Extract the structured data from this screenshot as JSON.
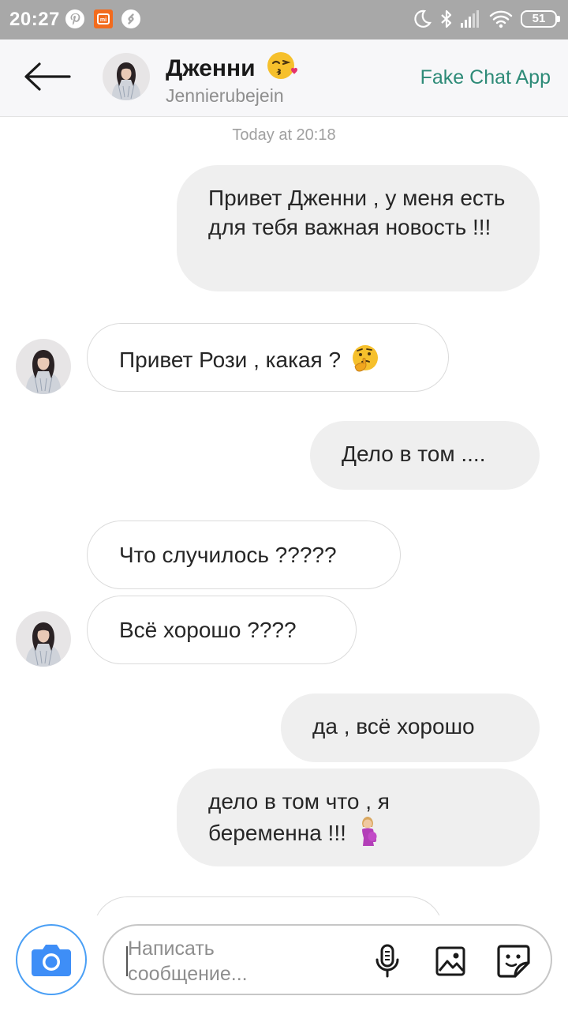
{
  "status_bar": {
    "time": "20:27",
    "battery": "51"
  },
  "header": {
    "name": "Дженни",
    "name_emoji": "face-blowing-kiss",
    "username": "Jennierubejein",
    "app_label": "Fake Chat App"
  },
  "chat": {
    "timestamp": "Today at 20:18",
    "messages": [
      {
        "side": "outgoing",
        "text": "Привет Дженни , у меня есть для тебя  важная новость !!!"
      },
      {
        "side": "incoming",
        "text": "Привет Рози , какая ?",
        "emoji": "thinking-face"
      },
      {
        "side": "outgoing",
        "text": "Дело в том ...."
      },
      {
        "side": "incoming",
        "text": "Что случилось ?????"
      },
      {
        "side": "incoming",
        "text": "Всё хорошо ????"
      },
      {
        "side": "outgoing",
        "text": "да , всё хорошо"
      },
      {
        "side": "outgoing",
        "text": "дело в том что , я беременна !!!",
        "emoji": "pregnant-woman"
      }
    ]
  },
  "composer": {
    "placeholder": "Написать сообщение...",
    "camera_color": "#3e8ef7",
    "accent_color": "#2e8b78"
  }
}
